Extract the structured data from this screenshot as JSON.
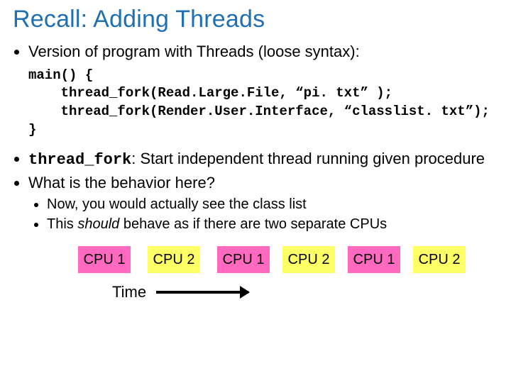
{
  "title": "Recall: Adding Threads",
  "bullets": {
    "b1": "Version of program with Threads (loose syntax):"
  },
  "code": {
    "l1": "main() {",
    "l2": "    thread_fork(Read.Large.File, “pi. txt” );",
    "l3": "    thread_fork(Render.User.Interface, “classlist. txt”);",
    "l4": "}"
  },
  "mid": {
    "tf_mono": "thread_fork",
    "tf_rest": ": Start independent thread running given procedure",
    "q": "What is the behavior here?"
  },
  "sub": {
    "s1": "Now, you would actually see the class list",
    "s2a": "This ",
    "s2_should": "should",
    "s2b": " behave as if there are two separate CPUs"
  },
  "cpu": {
    "c1": "CPU 1",
    "c2": "CPU 2"
  },
  "time_label": "Time"
}
